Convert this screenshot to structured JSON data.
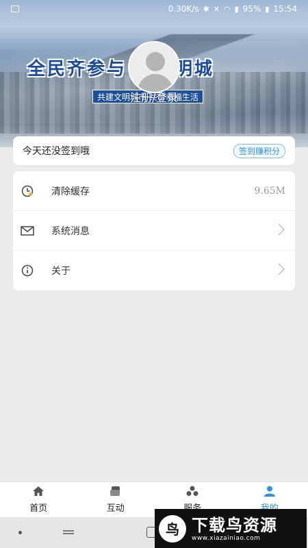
{
  "status_bar": {
    "speed": "0.30K/s",
    "battery": "95%",
    "time": "15:54"
  },
  "banner": {
    "headline": "全民齐参与 创文明城",
    "subtitle": "共建文明城市 共享幸福生活"
  },
  "profile": {
    "login_label": "注册/登录"
  },
  "signin": {
    "text": "今天还没签到哦",
    "button": "签到赚积分"
  },
  "menu": {
    "items": [
      {
        "label": "清除缓存",
        "value": "9.65M",
        "icon": "clock-icon"
      },
      {
        "label": "系统消息",
        "icon": "mail-icon"
      },
      {
        "label": "关于",
        "icon": "info-icon"
      }
    ]
  },
  "bottom_nav": {
    "items": [
      {
        "label": "首页",
        "icon": "home-icon"
      },
      {
        "label": "互动",
        "icon": "interact-icon"
      },
      {
        "label": "服务",
        "icon": "service-icon"
      },
      {
        "label": "我的",
        "icon": "user-icon"
      }
    ],
    "active_index": 3
  },
  "colors": {
    "accent": "#2b93d9",
    "background": "#ebebeb"
  },
  "watermark": {
    "title": "下载鸟资源",
    "url": "www.xiazainiao.com"
  }
}
